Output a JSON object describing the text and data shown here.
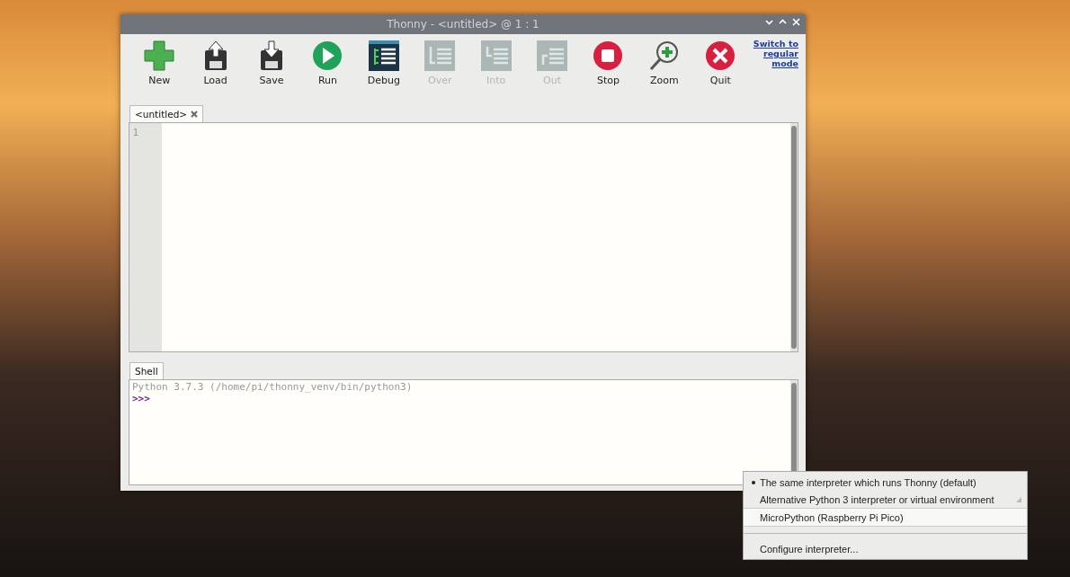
{
  "window": {
    "title": "Thonny  -  <untitled>  @  1 : 1"
  },
  "toolbar": {
    "buttons": [
      {
        "label": "New",
        "disabled": false
      },
      {
        "label": "Load",
        "disabled": false
      },
      {
        "label": "Save",
        "disabled": false
      },
      {
        "label": "Run",
        "disabled": false
      },
      {
        "label": "Debug",
        "disabled": false
      },
      {
        "label": "Over",
        "disabled": true
      },
      {
        "label": "Into",
        "disabled": true
      },
      {
        "label": "Out",
        "disabled": true
      },
      {
        "label": "Stop",
        "disabled": false
      },
      {
        "label": "Zoom",
        "disabled": false
      },
      {
        "label": "Quit",
        "disabled": false
      }
    ],
    "mode_link": "Switch to regular mode"
  },
  "editor": {
    "tabs": [
      {
        "label": "<untitled>",
        "selected": true
      }
    ],
    "line_numbers": [
      "1"
    ]
  },
  "shell": {
    "tabs": [
      {
        "label": "Shell",
        "selected": true
      }
    ],
    "output": "Python 3.7.3 (/home/pi/thonny_venv/bin/python3)",
    "prompt": ">>>"
  },
  "interpreter_menu": {
    "items": [
      {
        "kind": "item",
        "label": "The same interpreter which runs Thonny (default)",
        "checked": true,
        "submenu": false,
        "selected": false
      },
      {
        "kind": "item",
        "label": "Alternative Python 3 interpreter or virtual environment",
        "checked": false,
        "submenu": true,
        "selected": false
      },
      {
        "kind": "item",
        "label": "MicroPython (Raspberry Pi Pico)",
        "checked": false,
        "submenu": false,
        "selected": true
      },
      {
        "kind": "separator"
      },
      {
        "kind": "item",
        "label": "Configure interpreter...",
        "checked": false,
        "submenu": false,
        "selected": false
      }
    ]
  }
}
